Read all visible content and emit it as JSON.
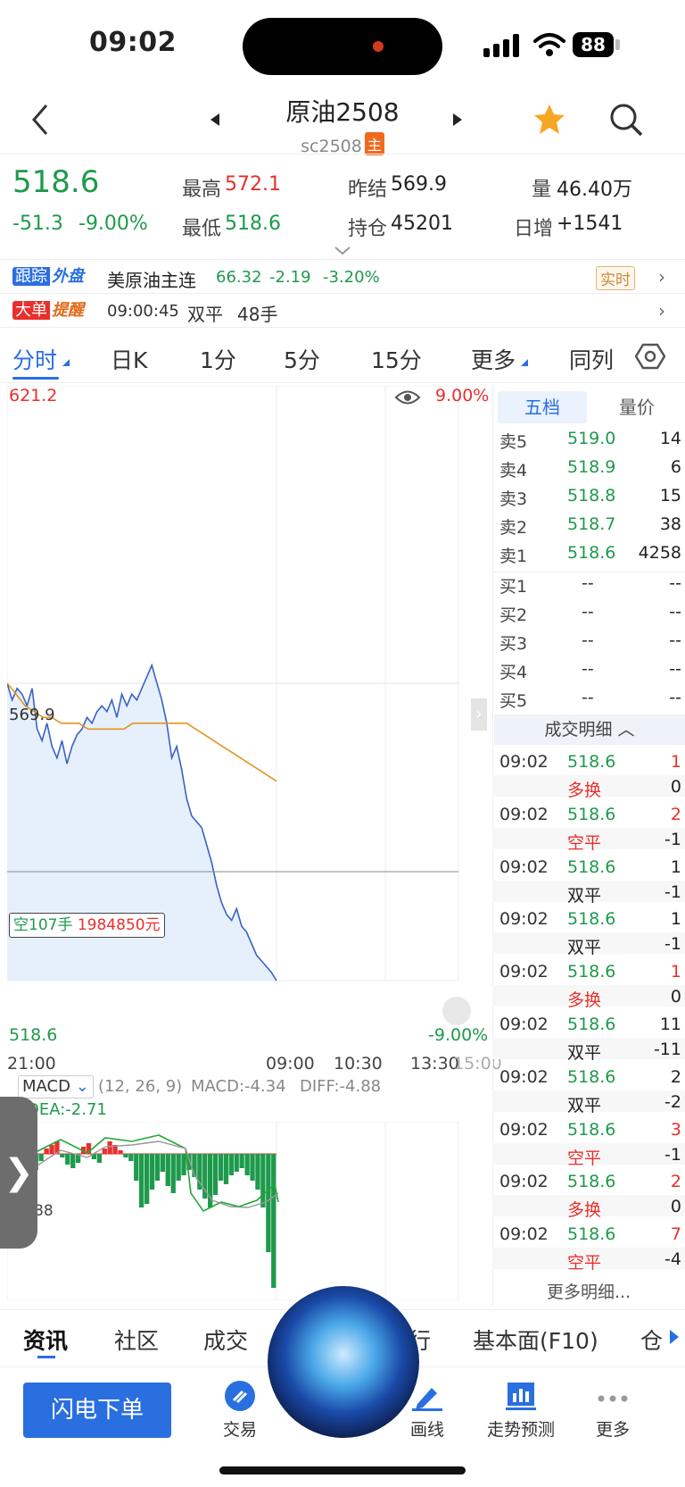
{
  "status_bar": {
    "time": "09:02",
    "battery": "88"
  },
  "header": {
    "title": "原油2508",
    "subtitle": "sc2508",
    "main_tag": "主"
  },
  "quote": {
    "price": "518.6",
    "change": "-51.3",
    "change_pct": "-9.00%",
    "high_label": "最高",
    "high": "572.1",
    "low_label": "最低",
    "low": "518.6",
    "prev_settle_label": "昨结",
    "prev_settle": "569.9",
    "open_interest_label": "持仓",
    "open_interest": "45201",
    "volume_label": "量",
    "volume": "46.40万",
    "daily_inc_label": "日增",
    "daily_inc": "+1541"
  },
  "tracking": {
    "badge_a": "跟踪",
    "badge_b": "外盘",
    "name": "美原油主连",
    "price": "66.32",
    "change": "-2.19",
    "pct": "-3.20%",
    "realtime": "实时"
  },
  "big_order": {
    "badge_a": "大单",
    "badge_b": "提醒",
    "time": "09:00:45",
    "type": "双平",
    "qty": "48手"
  },
  "chart_tabs": [
    "分时",
    "日K",
    "1分",
    "5分",
    "15分",
    "更多",
    "同列"
  ],
  "chart": {
    "top_price": "621.2",
    "top_pct": "9.00%",
    "ref_price": "569.9",
    "bottom_price": "518.6",
    "bottom_pct": "-9.00%",
    "x_labels": [
      "21:00",
      "09:00",
      "10:30",
      "13:30",
      "15:00"
    ],
    "cursor_label_a": "空107手",
    "cursor_label_b": "1984850元"
  },
  "chart_data": {
    "type": "line",
    "title": "",
    "xlabel": "",
    "ylabel": "",
    "ylim": [
      518.6,
      621.2
    ],
    "reference": 569.9,
    "series": [
      {
        "values": [
          569.9,
          567,
          569,
          568,
          566,
          569,
          562,
          560,
          563,
          559,
          557,
          560,
          556,
          559,
          561,
          562,
          564,
          563,
          565,
          566,
          565,
          567,
          564,
          568,
          566,
          568,
          567,
          569,
          571,
          573,
          570,
          567,
          563,
          557,
          559,
          555,
          550,
          547,
          546,
          545,
          542,
          539,
          535,
          532,
          530,
          529,
          531,
          528,
          527,
          525,
          523,
          522,
          521,
          520,
          518.6
        ]
      },
      {
        "values": [
          569.9,
          568,
          566,
          565,
          564,
          564,
          563,
          563,
          563,
          562,
          562,
          562,
          562,
          562,
          563,
          563,
          563,
          563,
          563,
          563,
          563,
          562,
          561,
          560,
          559,
          558,
          557,
          556,
          555,
          554,
          553
        ]
      }
    ]
  },
  "macd": {
    "dropdown": "MACD",
    "params": "(12, 26, 9)",
    "macd": "MACD:-4.34",
    "diff": "DIFF:-4.88",
    "dea": "DEA:-2.71",
    "left_tick": "88"
  },
  "order_book": {
    "tab_active": "五档",
    "tab_other": "量价",
    "asks": [
      {
        "label": "卖5",
        "price": "519.0",
        "vol": "14"
      },
      {
        "label": "卖4",
        "price": "518.9",
        "vol": "6"
      },
      {
        "label": "卖3",
        "price": "518.8",
        "vol": "15"
      },
      {
        "label": "卖2",
        "price": "518.7",
        "vol": "38"
      },
      {
        "label": "卖1",
        "price": "518.6",
        "vol": "4258"
      }
    ],
    "bids": [
      {
        "label": "买1",
        "price": "--",
        "vol": "--"
      },
      {
        "label": "买2",
        "price": "--",
        "vol": "--"
      },
      {
        "label": "买3",
        "price": "--",
        "vol": "--"
      },
      {
        "label": "买4",
        "price": "--",
        "vol": "--"
      },
      {
        "label": "买5",
        "price": "--",
        "vol": "--"
      }
    ],
    "detail_header": "成交明细",
    "more": "更多明细..."
  },
  "trades": [
    {
      "time": "09:02",
      "price": "518.6",
      "vol": "1",
      "kind": "多换",
      "delta": "0",
      "vol_red": true,
      "kind_red": true
    },
    {
      "time": "09:02",
      "price": "518.6",
      "vol": "2",
      "kind": "空平",
      "delta": "-1",
      "vol_red": true,
      "kind_red": true
    },
    {
      "time": "09:02",
      "price": "518.6",
      "vol": "1",
      "kind": "双平",
      "delta": "-1",
      "vol_red": false,
      "kind_red": false
    },
    {
      "time": "09:02",
      "price": "518.6",
      "vol": "1",
      "kind": "双平",
      "delta": "-1",
      "vol_red": false,
      "kind_red": false
    },
    {
      "time": "09:02",
      "price": "518.6",
      "vol": "1",
      "kind": "多换",
      "delta": "0",
      "vol_red": true,
      "kind_red": true
    },
    {
      "time": "09:02",
      "price": "518.6",
      "vol": "11",
      "kind": "双平",
      "delta": "-11",
      "vol_red": false,
      "kind_red": false
    },
    {
      "time": "09:02",
      "price": "518.6",
      "vol": "2",
      "kind": "双平",
      "delta": "-2",
      "vol_red": false,
      "kind_red": false
    },
    {
      "time": "09:02",
      "price": "518.6",
      "vol": "3",
      "kind": "空平",
      "delta": "-1",
      "vol_red": true,
      "kind_red": true
    },
    {
      "time": "09:02",
      "price": "518.6",
      "vol": "2",
      "kind": "多换",
      "delta": "0",
      "vol_red": true,
      "kind_red": true
    },
    {
      "time": "09:02",
      "price": "518.6",
      "vol": "7",
      "kind": "空平",
      "delta": "-4",
      "vol_red": true,
      "kind_red": true
    }
  ],
  "bottom_tabs": [
    "资讯",
    "社区",
    "成交",
    "行",
    "基本面(F10)",
    "仓"
  ],
  "bottom_nav": {
    "primary_button": "闪电下单",
    "items": [
      "交易",
      "画线",
      "走势预测",
      "更多"
    ]
  },
  "colors": {
    "up": "#e8302c",
    "down": "#1e9a4c",
    "accent": "#2a6fe0"
  }
}
